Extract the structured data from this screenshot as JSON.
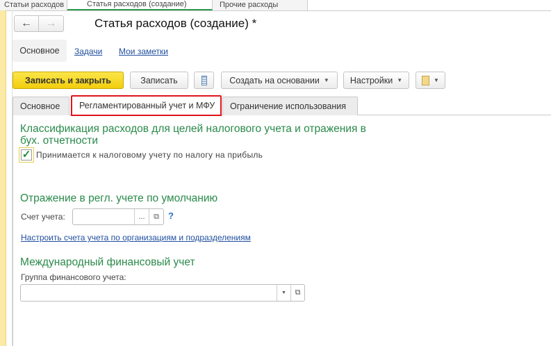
{
  "window_tabs": [
    {
      "label": "Статьи расходов"
    },
    {
      "label": "Статья расходов (создание)"
    },
    {
      "label": "Прочие расходы"
    }
  ],
  "header": {
    "title": "Статья расходов (создание) *",
    "back": "←",
    "forward": "→"
  },
  "nav": {
    "main": "Основное",
    "tasks": "Задачи",
    "notes": "Мои заметки"
  },
  "toolbar": {
    "save_close": "Записать и закрыть",
    "save": "Записать",
    "create_based": "Создать на основании",
    "settings": "Настройки"
  },
  "tabs": [
    {
      "label": "Основное"
    },
    {
      "label": "Регламентированный учет и МФУ",
      "active": true
    },
    {
      "label": "Ограничение использования"
    }
  ],
  "content": {
    "section1_title_line1": "Классификация расходов для целей налогового учета и отражения в",
    "section1_title_line2": "бух. отчетности",
    "tax_checkbox": {
      "label": "Принимается к налоговому учету по налогу на прибыль",
      "checked": true
    },
    "section2_title": "Отражение в регл. учете по умолчанию",
    "account_label": "Счет учета:",
    "account_value": "",
    "select_button": "...",
    "help": "?",
    "configure_link": "Настроить счета учета по организациям и подразделениям",
    "section3_title": "Международный финансовый учет",
    "fin_group_label": "Группа финансового учета:",
    "fin_group_value": ""
  },
  "colors": {
    "accent_green": "#2a8a4a",
    "primary_button": "#f2cd0c",
    "highlight_red": "#e0141b",
    "link": "#1f4e9e"
  }
}
